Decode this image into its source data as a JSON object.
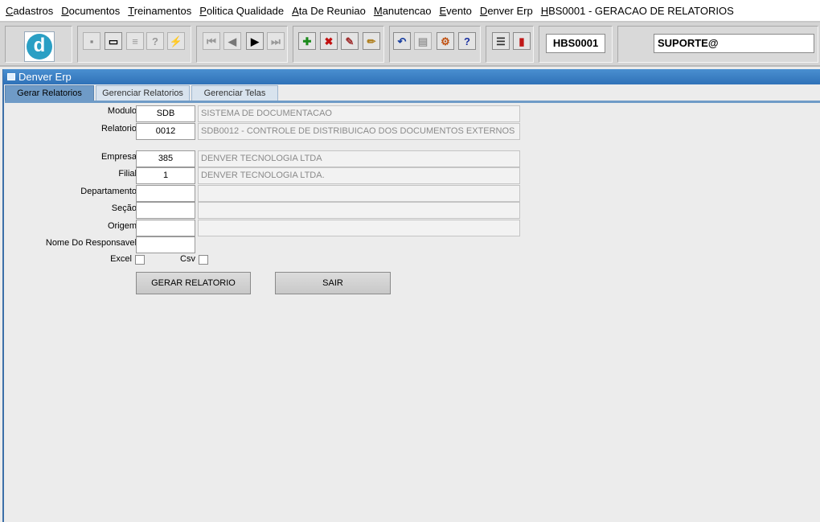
{
  "menu": [
    {
      "acc": "C",
      "rest": "adastros"
    },
    {
      "acc": "D",
      "rest": "ocumentos"
    },
    {
      "acc": "T",
      "rest": "reinamentos"
    },
    {
      "acc": "P",
      "rest": "olitica Qualidade"
    },
    {
      "acc": "A",
      "rest": "ta De Reuniao"
    },
    {
      "acc": "M",
      "rest": "anutencao"
    },
    {
      "acc": "E",
      "rest": "vento"
    },
    {
      "acc": "D",
      "rest": "enver Erp"
    },
    {
      "acc": "H",
      "rest": "BS0001 - GERACAO DE RELATORIOS"
    }
  ],
  "toolbar": {
    "logo_letter": "d",
    "form_code": "HBS0001",
    "user": "SUPORTE@",
    "icons": [
      {
        "name": "save-icon",
        "glyph": "▪",
        "color": "#888",
        "disabled": true
      },
      {
        "name": "window-icon",
        "glyph": "▭",
        "color": "#000",
        "disabled": false
      },
      {
        "name": "print-icon",
        "glyph": "≡",
        "color": "#999",
        "disabled": true
      },
      {
        "name": "query-icon",
        "glyph": "?",
        "color": "#999",
        "disabled": true
      },
      {
        "name": "execute-query-icon",
        "glyph": "⚡",
        "color": "#999",
        "disabled": true
      },
      {
        "name": "first-record-icon",
        "glyph": "⏮",
        "color": "#999",
        "disabled": true
      },
      {
        "name": "previous-record-icon",
        "glyph": "◀",
        "color": "#777",
        "disabled": true
      },
      {
        "name": "next-record-icon",
        "glyph": "▶",
        "color": "#000",
        "disabled": false
      },
      {
        "name": "last-record-icon",
        "glyph": "⏭",
        "color": "#999",
        "disabled": true
      },
      {
        "name": "add-record-icon",
        "glyph": "✚",
        "color": "#1a8a1a",
        "disabled": false
      },
      {
        "name": "delete-record-icon",
        "glyph": "✖",
        "color": "#c21010",
        "disabled": false
      },
      {
        "name": "clear-record-icon",
        "glyph": "✎",
        "color": "#a03030",
        "disabled": false
      },
      {
        "name": "edit-record-icon",
        "glyph": "✏",
        "color": "#b08020",
        "disabled": false
      },
      {
        "name": "undo-icon",
        "glyph": "↶",
        "color": "#1a3fa0",
        "disabled": false
      },
      {
        "name": "clipboard-icon",
        "glyph": "▤",
        "color": "#999",
        "disabled": true
      },
      {
        "name": "tools-icon",
        "glyph": "⚙",
        "color": "#c05010",
        "disabled": false
      },
      {
        "name": "help-icon",
        "glyph": "?",
        "color": "#1a2fa0",
        "disabled": false
      },
      {
        "name": "menu-icon",
        "glyph": "☰",
        "color": "#333",
        "disabled": false
      },
      {
        "name": "exit-icon",
        "glyph": "▮",
        "color": "#c01818",
        "disabled": false
      }
    ]
  },
  "window": {
    "title": "Denver Erp"
  },
  "tabs": [
    "Gerar Relatorios",
    "Gerenciar Relatorios",
    "Gerenciar Telas"
  ],
  "form": {
    "modulo_label": "Modulo",
    "modulo_code": "SDB",
    "modulo_desc": "SISTEMA DE DOCUMENTACAO",
    "relatorio_label": "Relatorio",
    "relatorio_code": "0012",
    "relatorio_desc": "SDB0012 - CONTROLE DE DISTRIBUICAO DOS DOCUMENTOS EXTERNOS",
    "empresa_label": "Empresa",
    "empresa_code": "385",
    "empresa_desc": "DENVER TECNOLOGIA LTDA",
    "filial_label": "Filial",
    "filial_code": "1",
    "filial_desc": "DENVER TECNOLOGIA LTDA.",
    "departamento_label": "Departamento",
    "departamento_code": "",
    "departamento_desc": "",
    "secao_label": "Seção",
    "secao_code": "",
    "secao_desc": "",
    "origem_label": "Origem",
    "origem_code": "",
    "origem_desc": "",
    "responsavel_label": "Nome Do Responsavel",
    "responsavel_value": "",
    "excel_label": "Excel",
    "csv_label": "Csv",
    "gerar_button": "GERAR RELATORIO",
    "sair_button": "SAIR"
  }
}
